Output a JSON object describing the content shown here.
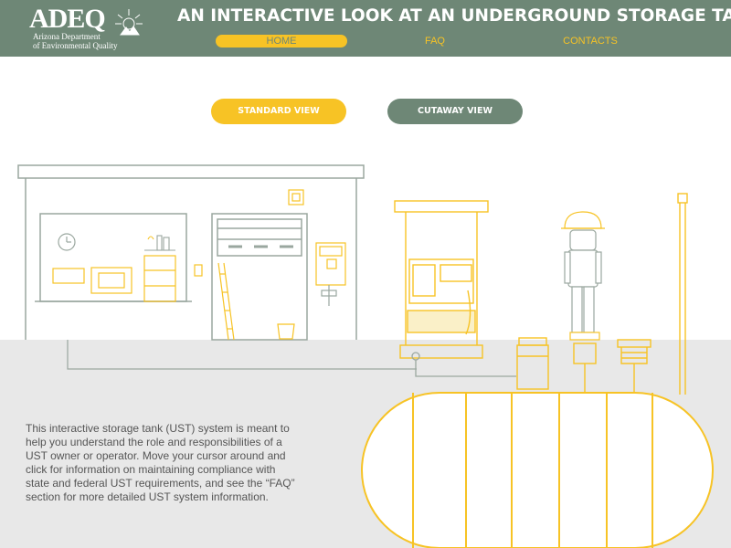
{
  "header": {
    "logo": {
      "word": "ADEQ",
      "sub_line1": "Arizona Department",
      "sub_line2": "of Environmental Quality"
    },
    "title": "AN INTERACTIVE LOOK AT AN UNDERGROUND STORAGE TANK",
    "nav": {
      "home": "HOME",
      "faq": "FAQ",
      "contacts": "CONTACTS"
    }
  },
  "views": {
    "standard": "STANDARD VIEW",
    "cutaway": "CUTAWAY VIEW",
    "active": "standard"
  },
  "description": "This interactive storage tank (UST) system is meant to help you understand the role and responsibilities of a UST owner or operator. Move your cursor around and click for information on maintaining compliance with state and federal UST requirements, and see the “FAQ” section for more detailed UST system information.",
  "colors": {
    "header_bg": "#6e8776",
    "accent_yellow": "#f7c325",
    "line_gray": "#9aa79f",
    "ground": "#e8e8e8",
    "text": "#555555"
  }
}
